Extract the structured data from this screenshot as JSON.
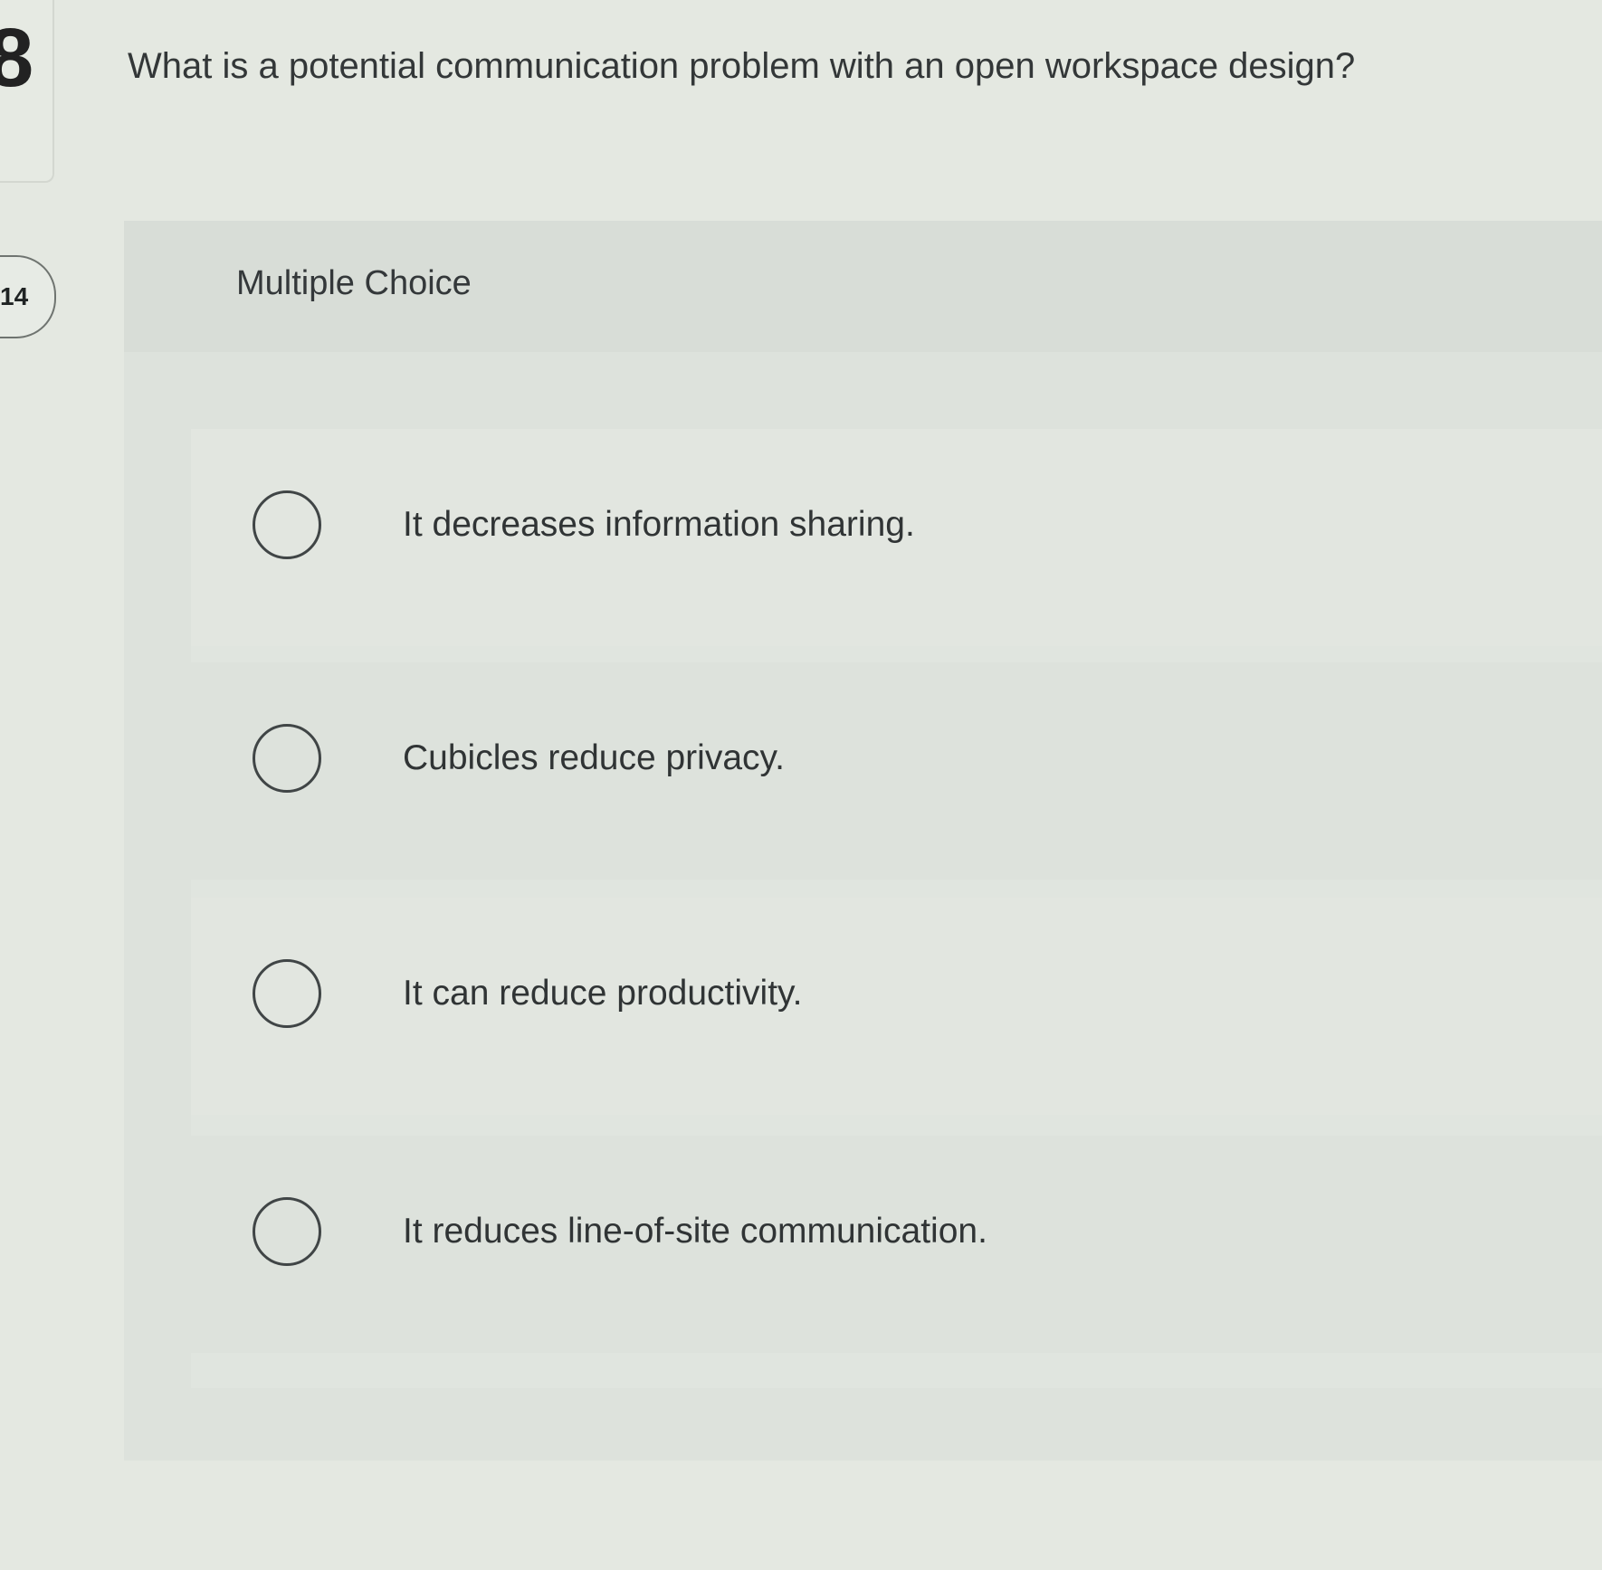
{
  "question": {
    "number_fragment": "8",
    "points": "14",
    "text": "What is a potential communication problem with an open workspace design?"
  },
  "answer_panel": {
    "header": "Multiple Choice",
    "options": [
      {
        "label": "It decreases information sharing."
      },
      {
        "label": "Cubicles reduce privacy."
      },
      {
        "label": "It can reduce productivity."
      },
      {
        "label": "It reduces line-of-site communication."
      }
    ]
  }
}
